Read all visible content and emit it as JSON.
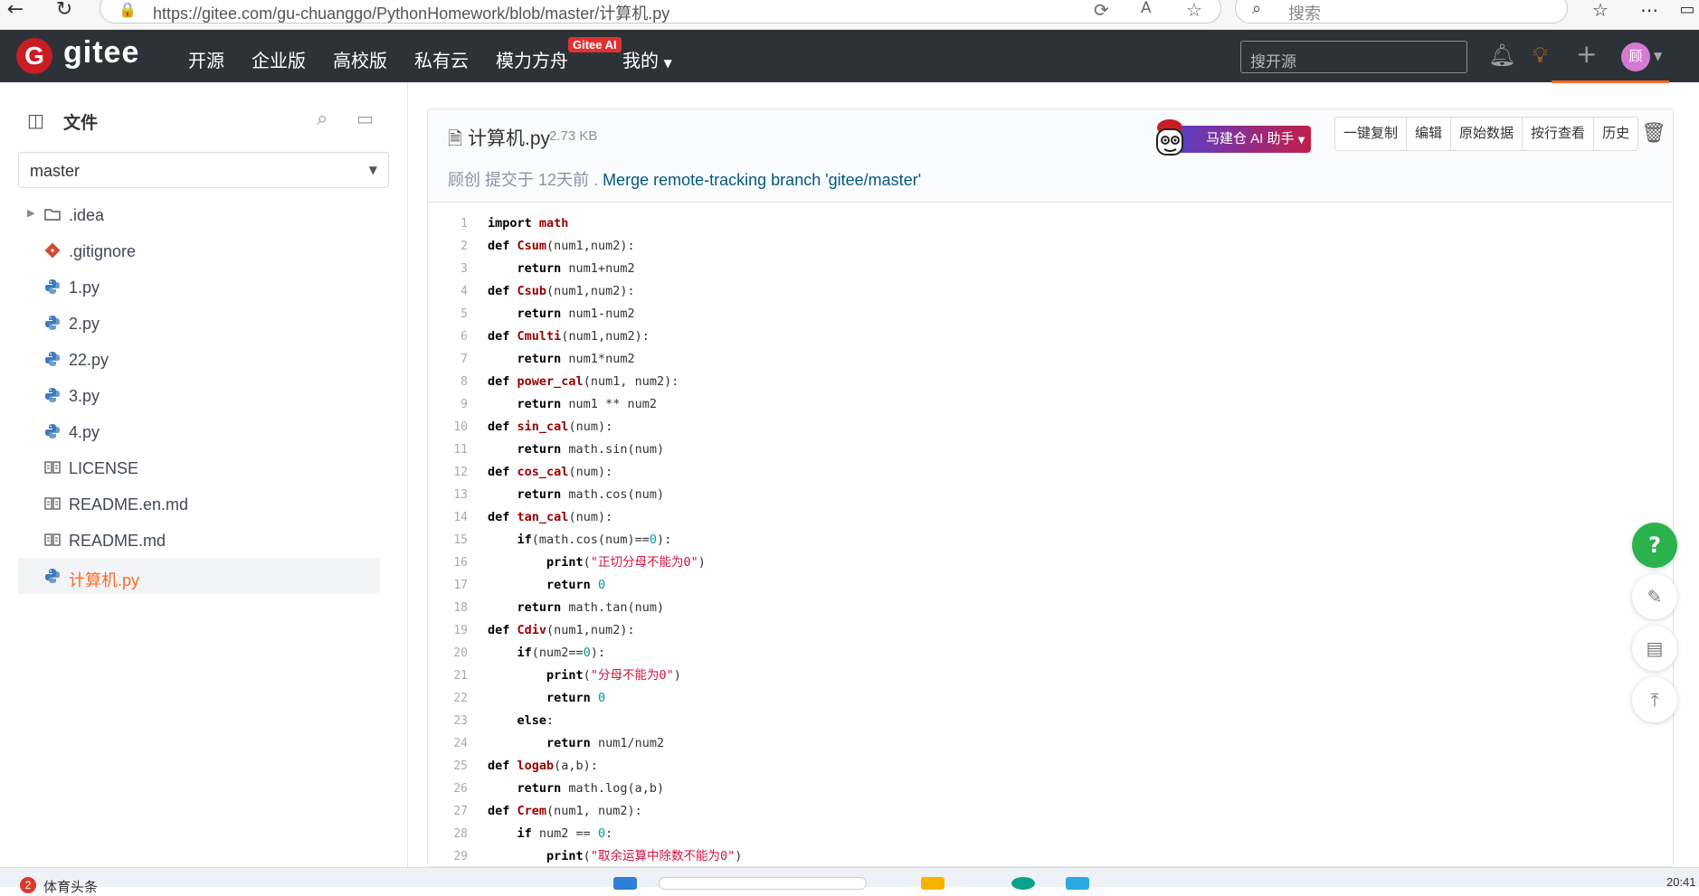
{
  "browser": {
    "url": "https://gitee.com/gu-chuanggo/PythonHomework/blob/master/计算机.py",
    "search_placeholder": "搜索"
  },
  "nav": {
    "logo_text": "gitee",
    "items": [
      "开源",
      "企业版",
      "高校版",
      "私有云",
      "模力方舟",
      "我的"
    ],
    "ai_badge": "Gitee AI",
    "search_placeholder": "搜开源",
    "avatar_text": "顾"
  },
  "sidebar": {
    "title": "文件",
    "branch": "master",
    "files": [
      {
        "name": ".idea",
        "type": "folder"
      },
      {
        "name": ".gitignore",
        "type": "git"
      },
      {
        "name": "1.py",
        "type": "python"
      },
      {
        "name": "2.py",
        "type": "python"
      },
      {
        "name": "22.py",
        "type": "python"
      },
      {
        "name": "3.py",
        "type": "python"
      },
      {
        "name": "4.py",
        "type": "python"
      },
      {
        "name": "LICENSE",
        "type": "book"
      },
      {
        "name": "README.en.md",
        "type": "book"
      },
      {
        "name": "README.md",
        "type": "book"
      },
      {
        "name": "计算机.py",
        "type": "python",
        "active": true
      }
    ]
  },
  "file": {
    "name": "计算机.py",
    "size": "2.73 KB",
    "ai_button": "马建仓 AI 助手",
    "actions": [
      "一键复制",
      "编辑",
      "原始数据",
      "按行查看",
      "历史"
    ],
    "commit_author": "顾创",
    "commit_verb": "提交于",
    "commit_time": "12天前",
    "commit_message": "Merge remote-tracking branch 'gitee/master'"
  },
  "code_lines": [
    "import math",
    "def Csum(num1,num2):",
    "    return num1+num2",
    "def Csub(num1,num2):",
    "    return num1-num2",
    "def Cmulti(num1,num2):",
    "    return num1*num2",
    "def power_cal(num1, num2):",
    "    return num1 ** num2",
    "def sin_cal(num):",
    "    return math.sin(num)",
    "def cos_cal(num):",
    "    return math.cos(num)",
    "def tan_cal(num):",
    "    if(math.cos(num)==0):",
    "        print(\"正切分母不能为0\")",
    "        return 0",
    "    return math.tan(num)",
    "def Cdiv(num1,num2):",
    "    if(num2==0):",
    "        print(\"分母不能为0\")",
    "        return 0",
    "    else:",
    "        return num1/num2",
    "def logab(a,b):",
    "    return math.log(a,b)",
    "def Crem(num1, num2):",
    "    if num2 == 0:",
    "        print(\"取余运算中除数不能为0\")"
  ],
  "taskbar": {
    "badge": "2",
    "text": "体育头条",
    "time": "20:41"
  }
}
